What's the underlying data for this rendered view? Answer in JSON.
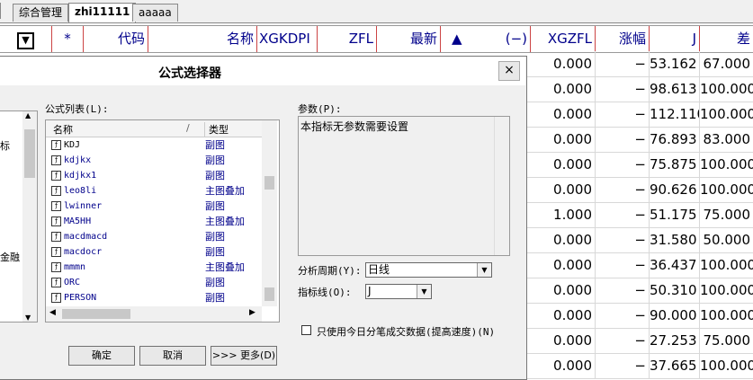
{
  "tabs": [
    {
      "label": "综合管理",
      "active": false
    },
    {
      "label": "zhi11111",
      "active": true
    },
    {
      "label": "aaaaa",
      "active": false
    }
  ],
  "header": {
    "col_star": "*",
    "col_code": "代码",
    "col_name": "名称",
    "col_xgkdp": "XGKDPI",
    "col_zfl": "ZFL",
    "col_latest": "最新",
    "col_sort": "▲",
    "col_sort_paren": "(−)",
    "col_xgzfl": "XGZFL",
    "col_change": "涨幅",
    "col_j": "J",
    "col_diff": "差"
  },
  "rows": [
    {
      "xgzfl": "0.000",
      "change": "−",
      "j": "53.162",
      "diff": "67.000"
    },
    {
      "xgzfl": "0.000",
      "change": "−",
      "j": "98.613",
      "diff": "100.000"
    },
    {
      "xgzfl": "0.000",
      "change": "−",
      "j": "112.110",
      "diff": "100.000"
    },
    {
      "xgzfl": "0.000",
      "change": "−",
      "j": "76.893",
      "diff": "83.000"
    },
    {
      "xgzfl": "0.000",
      "change": "−",
      "j": "75.875",
      "diff": "100.000"
    },
    {
      "xgzfl": "0.000",
      "change": "−",
      "j": "90.626",
      "diff": "100.000"
    },
    {
      "xgzfl": "1.000",
      "change": "−",
      "j": "51.175",
      "diff": "75.000"
    },
    {
      "xgzfl": "0.000",
      "change": "−",
      "j": "31.580",
      "diff": "50.000"
    },
    {
      "xgzfl": "0.000",
      "change": "−",
      "j": "36.437",
      "diff": "100.000"
    },
    {
      "xgzfl": "0.000",
      "change": "−",
      "j": "50.310",
      "diff": "100.000"
    },
    {
      "xgzfl": "0.000",
      "change": "−",
      "j": "90.000",
      "diff": "100.000"
    },
    {
      "xgzfl": "0.000",
      "change": "−",
      "j": "27.253",
      "diff": "75.000"
    },
    {
      "xgzfl": "0.000",
      "change": "−",
      "j": "37.665",
      "diff": "100.000"
    }
  ],
  "dialog": {
    "title": "公式选择器",
    "close": "×",
    "list_label": "公式列表(L):",
    "list_col_name": "名称",
    "list_col_sep": "/",
    "list_col_type": "类型",
    "formulas": [
      {
        "name": "KDJ",
        "type": "副图"
      },
      {
        "name": "kdjkx",
        "type": "副图"
      },
      {
        "name": "kdjkx1",
        "type": "副图"
      },
      {
        "name": "leo8li",
        "type": "主图叠加"
      },
      {
        "name": "lwinner",
        "type": "副图"
      },
      {
        "name": "MA5HH",
        "type": "主图叠加"
      },
      {
        "name": "macdmacd",
        "type": "副图"
      },
      {
        "name": "macdocr",
        "type": "副图"
      },
      {
        "name": "mmmn",
        "type": "主图叠加"
      },
      {
        "name": "ORC",
        "type": "副图"
      },
      {
        "name": "PERSON",
        "type": "副图"
      }
    ],
    "left_items": [
      "标",
      "金融"
    ],
    "params_label": "参数(P):",
    "params_text": "本指标无参数需要设置",
    "period_label": "分析周期(Y):",
    "period_value": "日线",
    "indicator_label": "指标线(O):",
    "indicator_value": "J",
    "checkbox_label": "只使用今日分笔成交数据(提高速度)(N)",
    "btn_ok": "确定",
    "btn_cancel": "取消",
    "btn_more": ">>> 更多(D)"
  }
}
